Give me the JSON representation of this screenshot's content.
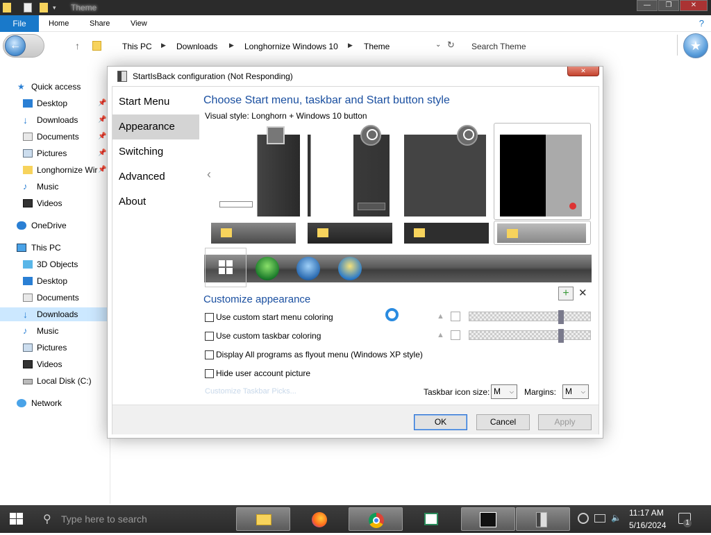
{
  "window": {
    "title": "Theme",
    "min": "—",
    "max": "❐",
    "close": "✕"
  },
  "ribbon": {
    "tabs": [
      "File",
      "Home",
      "Share",
      "View"
    ],
    "help": "?"
  },
  "address": {
    "crumbs": [
      "This PC",
      "Downloads",
      "Longhornize Windows 10",
      "Theme"
    ],
    "search_placeholder": "Search Theme",
    "back_glyph": "←",
    "fav_glyph": "★",
    "up_glyph": "↑",
    "chev": "▶",
    "dd": "⌄",
    "refresh_glyph": "↻"
  },
  "nav": {
    "quick_access": "Quick access",
    "quick_items": [
      "Desktop",
      "Downloads",
      "Documents",
      "Pictures",
      "Longhornize Wir",
      "Music",
      "Videos"
    ],
    "onedrive": "OneDrive",
    "this_pc": "This PC",
    "pc_items": [
      "3D Objects",
      "Desktop",
      "Documents",
      "Downloads",
      "Music",
      "Pictures",
      "Videos",
      "Local Disk (C:)"
    ],
    "network": "Network",
    "selected": "Downloads",
    "pin": "📌"
  },
  "dialog": {
    "title": "StartIsBack configuration (Not Responding)",
    "close": "✕",
    "menu": [
      "Start Menu",
      "Appearance",
      "Switching",
      "Advanced",
      "About"
    ],
    "selected_menu": "Appearance",
    "heading": "Choose Start menu, taskbar and Start button style",
    "visual_style": "Visual style:  Longhorn + Windows 10 button",
    "prev": "‹",
    "customize_heading": "Customize appearance",
    "add": "+",
    "remove": "✕",
    "checkboxes": [
      {
        "label": "Use custom start menu coloring",
        "checked": false
      },
      {
        "label": "Use custom taskbar coloring",
        "checked": false
      },
      {
        "label": "Display All programs as flyout menu (Windows XP style)",
        "checked": false
      },
      {
        "label": "Hide user account picture",
        "checked": false
      }
    ],
    "customize_link": "Customize Taskbar Picks...",
    "taskbar_icon_size_label": "Taskbar icon size:",
    "taskbar_icon_size": "M",
    "margins_label": "Margins:",
    "margins": "M",
    "drop": "⌵",
    "buttons": {
      "ok": "OK",
      "cancel": "Cancel",
      "apply": "Apply"
    },
    "drop_glyph": "▲"
  },
  "taskbar": {
    "search_placeholder": "Type here to search",
    "time": "11:17 AM",
    "date": "5/16/2024",
    "notifications": "1",
    "search_glyph": "⚲",
    "volume_glyph": "🔈"
  },
  "colors": {
    "accent": "#1979ca",
    "heading": "#1a4fa0"
  }
}
